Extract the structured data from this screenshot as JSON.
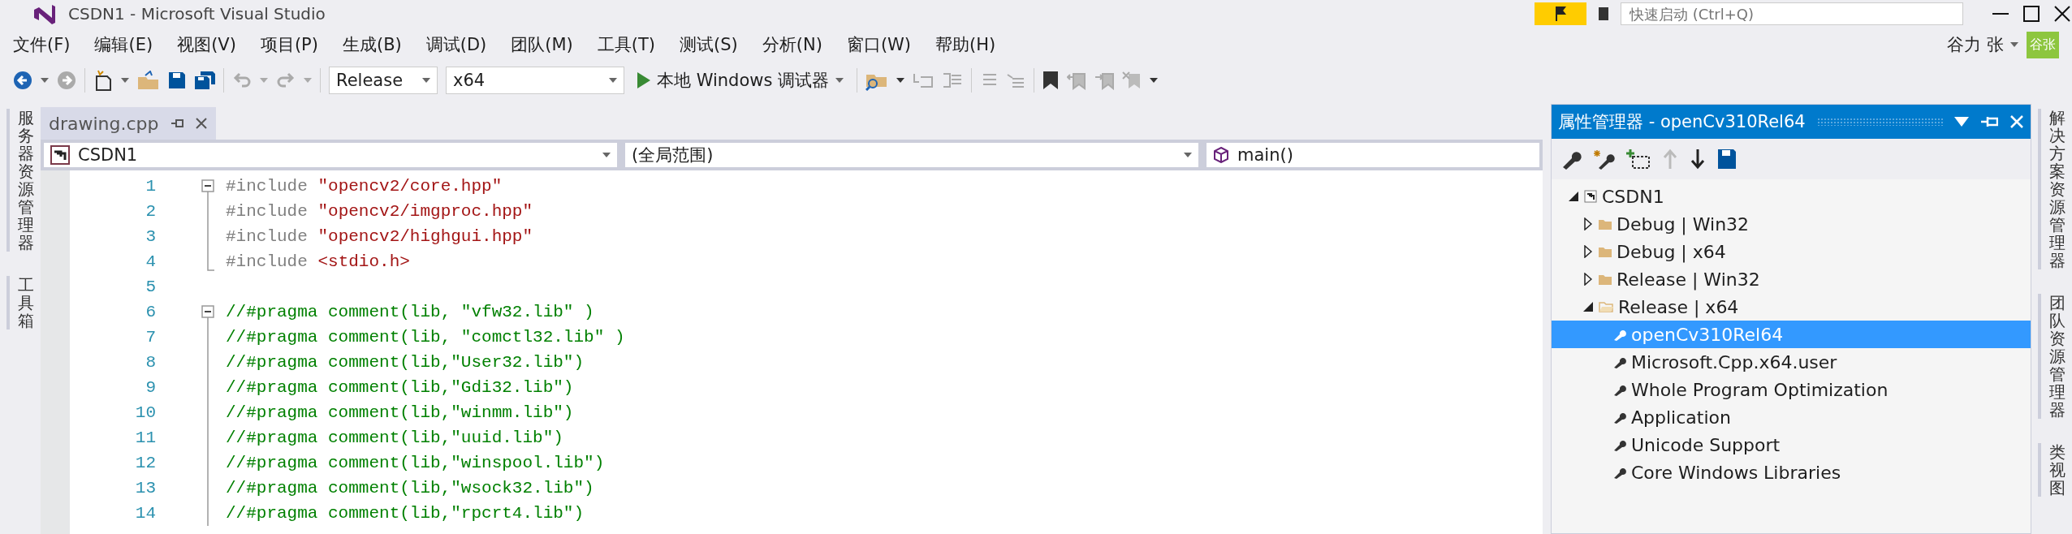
{
  "window": {
    "title": "CSDN1 - Microsoft Visual Studio"
  },
  "quick_launch": {
    "placeholder": "快速启动 (Ctrl+Q)"
  },
  "menu": [
    "文件(F)",
    "编辑(E)",
    "视图(V)",
    "项目(P)",
    "生成(B)",
    "调试(D)",
    "团队(M)",
    "工具(T)",
    "测试(S)",
    "分析(N)",
    "窗口(W)",
    "帮助(H)"
  ],
  "account": {
    "name": "谷力 张",
    "avatar": "谷张"
  },
  "toolbar": {
    "configuration": "Release",
    "platform": "x64",
    "debugger": "本地 Windows 调试器"
  },
  "left_strip": [
    "服务器资源管理器",
    "工具箱"
  ],
  "editor": {
    "tab": {
      "title": "drawing.cpp",
      "selected": true
    },
    "nav": {
      "project": "CSDN1",
      "scope": "(全局范围)",
      "member": "main()"
    },
    "lines": [
      {
        "number": "1",
        "kind": "fold-start",
        "segments": [
          {
            "kind": "directive",
            "text": "#include "
          },
          {
            "kind": "string",
            "text": "\"opencv2/core.hpp\""
          }
        ]
      },
      {
        "number": "2",
        "kind": "fold-inner",
        "segments": [
          {
            "kind": "directive",
            "text": "#include "
          },
          {
            "kind": "string",
            "text": "\"opencv2/imgproc.hpp\""
          }
        ]
      },
      {
        "number": "3",
        "kind": "fold-inner",
        "segments": [
          {
            "kind": "directive",
            "text": "#include "
          },
          {
            "kind": "string",
            "text": "\"opencv2/highgui.hpp\""
          }
        ]
      },
      {
        "number": "4",
        "kind": "fold-end",
        "segments": [
          {
            "kind": "directive",
            "text": "#include "
          },
          {
            "kind": "string",
            "text": "<stdio.h>"
          }
        ]
      },
      {
        "number": "5"
      },
      {
        "number": "6",
        "kind": "fold-start",
        "segments": [
          {
            "kind": "comment",
            "text": "//#pragma comment(lib, \"vfw32.lib\" )"
          }
        ]
      },
      {
        "number": "7",
        "kind": "fold-inner",
        "segments": [
          {
            "kind": "comment",
            "text": "//#pragma comment(lib, \"comctl32.lib\" )"
          }
        ]
      },
      {
        "number": "8",
        "kind": "fold-inner",
        "segments": [
          {
            "kind": "comment",
            "text": "//#pragma comment(lib,\"User32.lib\")"
          }
        ]
      },
      {
        "number": "9",
        "kind": "fold-inner",
        "segments": [
          {
            "kind": "comment",
            "text": "//#pragma comment(lib,\"Gdi32.lib\")"
          }
        ]
      },
      {
        "number": "10",
        "kind": "fold-inner",
        "segments": [
          {
            "kind": "comment",
            "text": "//#pragma comment(lib,\"winmm.lib\")"
          }
        ]
      },
      {
        "number": "11",
        "kind": "fold-inner",
        "segments": [
          {
            "kind": "comment",
            "text": "//#pragma comment(lib,\"uuid.lib\")"
          }
        ]
      },
      {
        "number": "12",
        "kind": "fold-inner",
        "segments": [
          {
            "kind": "comment",
            "text": "//#pragma comment(lib,\"winspool.lib\")"
          }
        ]
      },
      {
        "number": "13",
        "kind": "fold-inner",
        "segments": [
          {
            "kind": "comment",
            "text": "//#pragma comment(lib,\"wsock32.lib\")"
          }
        ]
      },
      {
        "number": "14",
        "kind": "fold-inner",
        "segments": [
          {
            "kind": "comment",
            "text": "//#pragma comment(lib,\"rpcrt4.lib\")"
          }
        ]
      }
    ]
  },
  "property_manager": {
    "title": "属性管理器 - openCv310Rel64",
    "tree": [
      {
        "label": "CSDN1",
        "kind": "project",
        "expanded": true,
        "selected": false,
        "children": [
          {
            "label": "Debug | Win32",
            "kind": "configuration",
            "expanded": false,
            "selected": false
          },
          {
            "label": "Debug | x64",
            "kind": "configuration",
            "expanded": false,
            "selected": false
          },
          {
            "label": "Release | Win32",
            "kind": "configuration",
            "expanded": false,
            "selected": false
          },
          {
            "label": "Release | x64",
            "kind": "configuration",
            "expanded": true,
            "selected": false,
            "children": [
              {
                "label": "openCv310Rel64",
                "kind": "sheet",
                "selected": true
              },
              {
                "label": "Microsoft.Cpp.x64.user",
                "kind": "sheet",
                "selected": false
              },
              {
                "label": "Whole Program Optimization",
                "kind": "sheet",
                "selected": false
              },
              {
                "label": "Application",
                "kind": "sheet",
                "selected": false
              },
              {
                "label": "Unicode Support",
                "kind": "sheet",
                "selected": false
              },
              {
                "label": "Core Windows Libraries",
                "kind": "sheet",
                "selected": false
              }
            ]
          }
        ]
      }
    ]
  },
  "right_strip": [
    "解决方案资源管理器",
    "团队资源管理器",
    "类视图"
  ]
}
